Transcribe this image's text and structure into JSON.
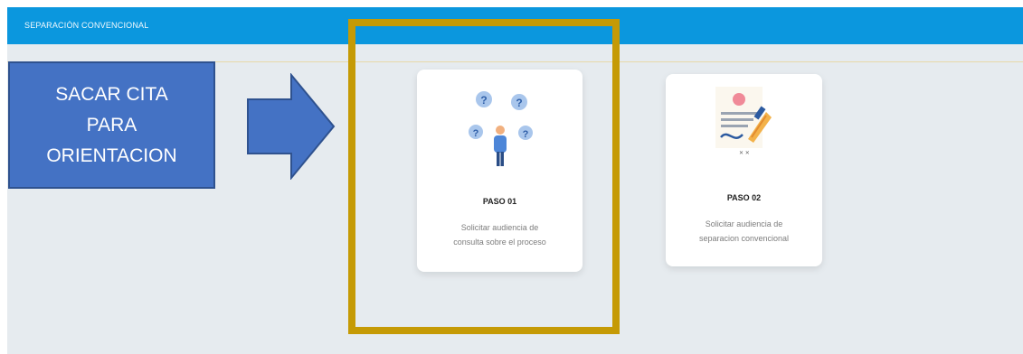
{
  "header": {
    "title": "SEPARACIÓN CONVENCIONAL"
  },
  "callout": {
    "lines": [
      "SACAR CITA",
      "PARA",
      "ORIENTACION"
    ]
  },
  "steps": [
    {
      "label": "PASO 01",
      "desc_lines": [
        "Solicitar audiencia de",
        "consulta sobre el proceso"
      ],
      "icon": "person-questions-icon"
    },
    {
      "label": "PASO 02",
      "desc_lines": [
        "Solicitar audiencia de",
        "separacion convencional"
      ],
      "icon": "document-signature-icon"
    }
  ],
  "colors": {
    "topbar": "#0b97de",
    "background": "#e6ebef",
    "highlight": "#c59a05",
    "callout": "#4472c4"
  }
}
